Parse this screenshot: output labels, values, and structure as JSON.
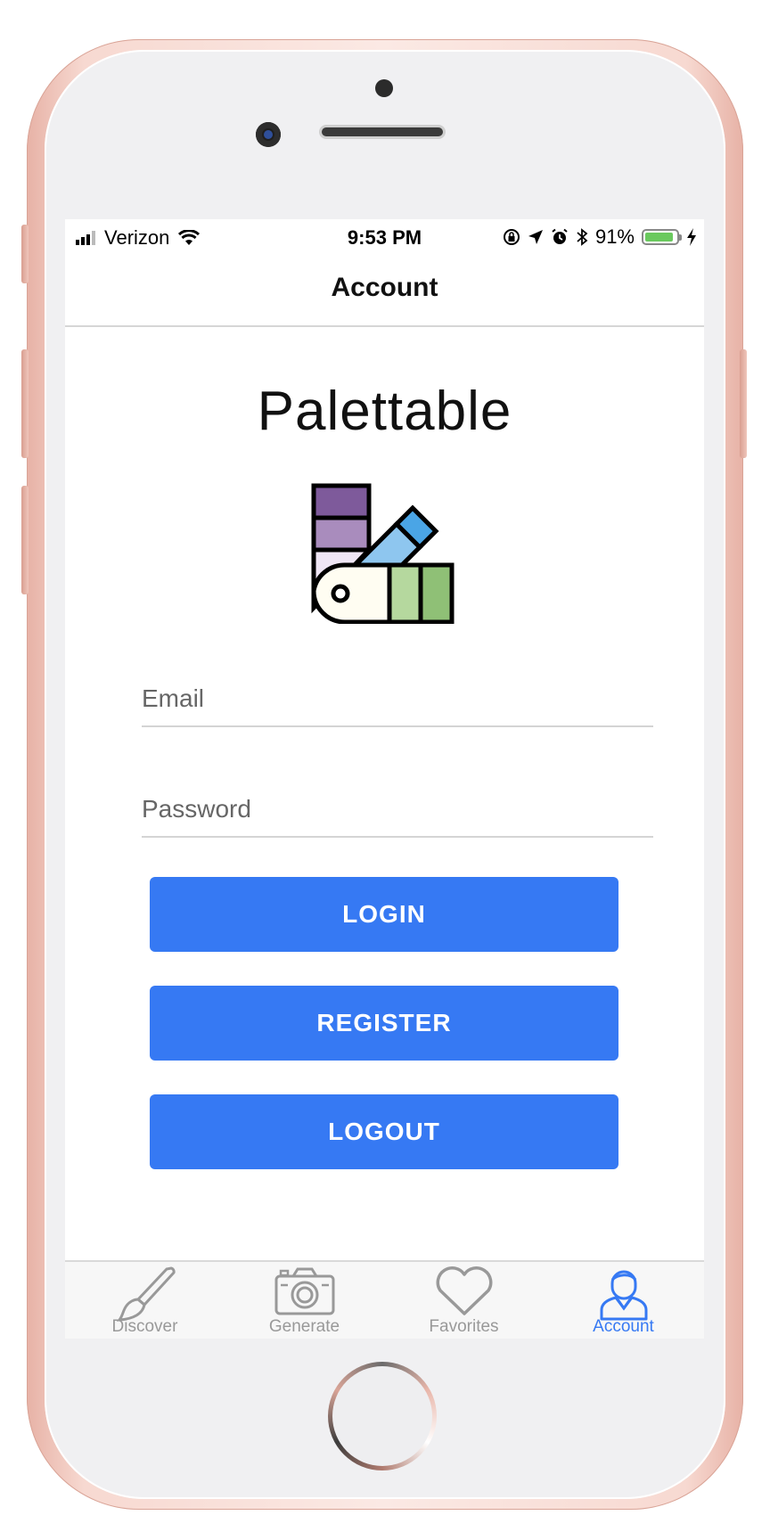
{
  "status_bar": {
    "carrier": "Verizon",
    "time": "9:53 PM",
    "battery_percent": "91%",
    "battery_level": 0.91,
    "icons": [
      "signal-icon",
      "wifi-icon",
      "rotation-lock-icon",
      "location-icon",
      "alarm-icon",
      "bluetooth-icon",
      "battery-icon",
      "charging-icon"
    ]
  },
  "nav": {
    "title": "Account"
  },
  "app": {
    "name": "Palettable",
    "logo_icon": "color-swatch-fan-icon"
  },
  "form": {
    "email_placeholder": "Email",
    "email_value": "",
    "password_placeholder": "Password",
    "password_value": ""
  },
  "buttons": {
    "login": "LOGIN",
    "register": "REGISTER",
    "logout": "LOGOUT"
  },
  "tabs": [
    {
      "label": "Discover",
      "icon": "paintbrush-icon",
      "active": false
    },
    {
      "label": "Generate",
      "icon": "camera-icon",
      "active": false
    },
    {
      "label": "Favorites",
      "icon": "heart-icon",
      "active": false
    },
    {
      "label": "Account",
      "icon": "user-icon",
      "active": true
    }
  ],
  "colors": {
    "accent": "#3679f3",
    "tab_inactive": "#999999",
    "swatch_purple_dark": "#7e5a9b",
    "swatch_purple_light": "#a98cbd",
    "swatch_blue_dark": "#4aa5e6",
    "swatch_blue_light": "#8ec6ef",
    "swatch_green_light": "#b5d89e",
    "swatch_green_dark": "#8fc076"
  }
}
